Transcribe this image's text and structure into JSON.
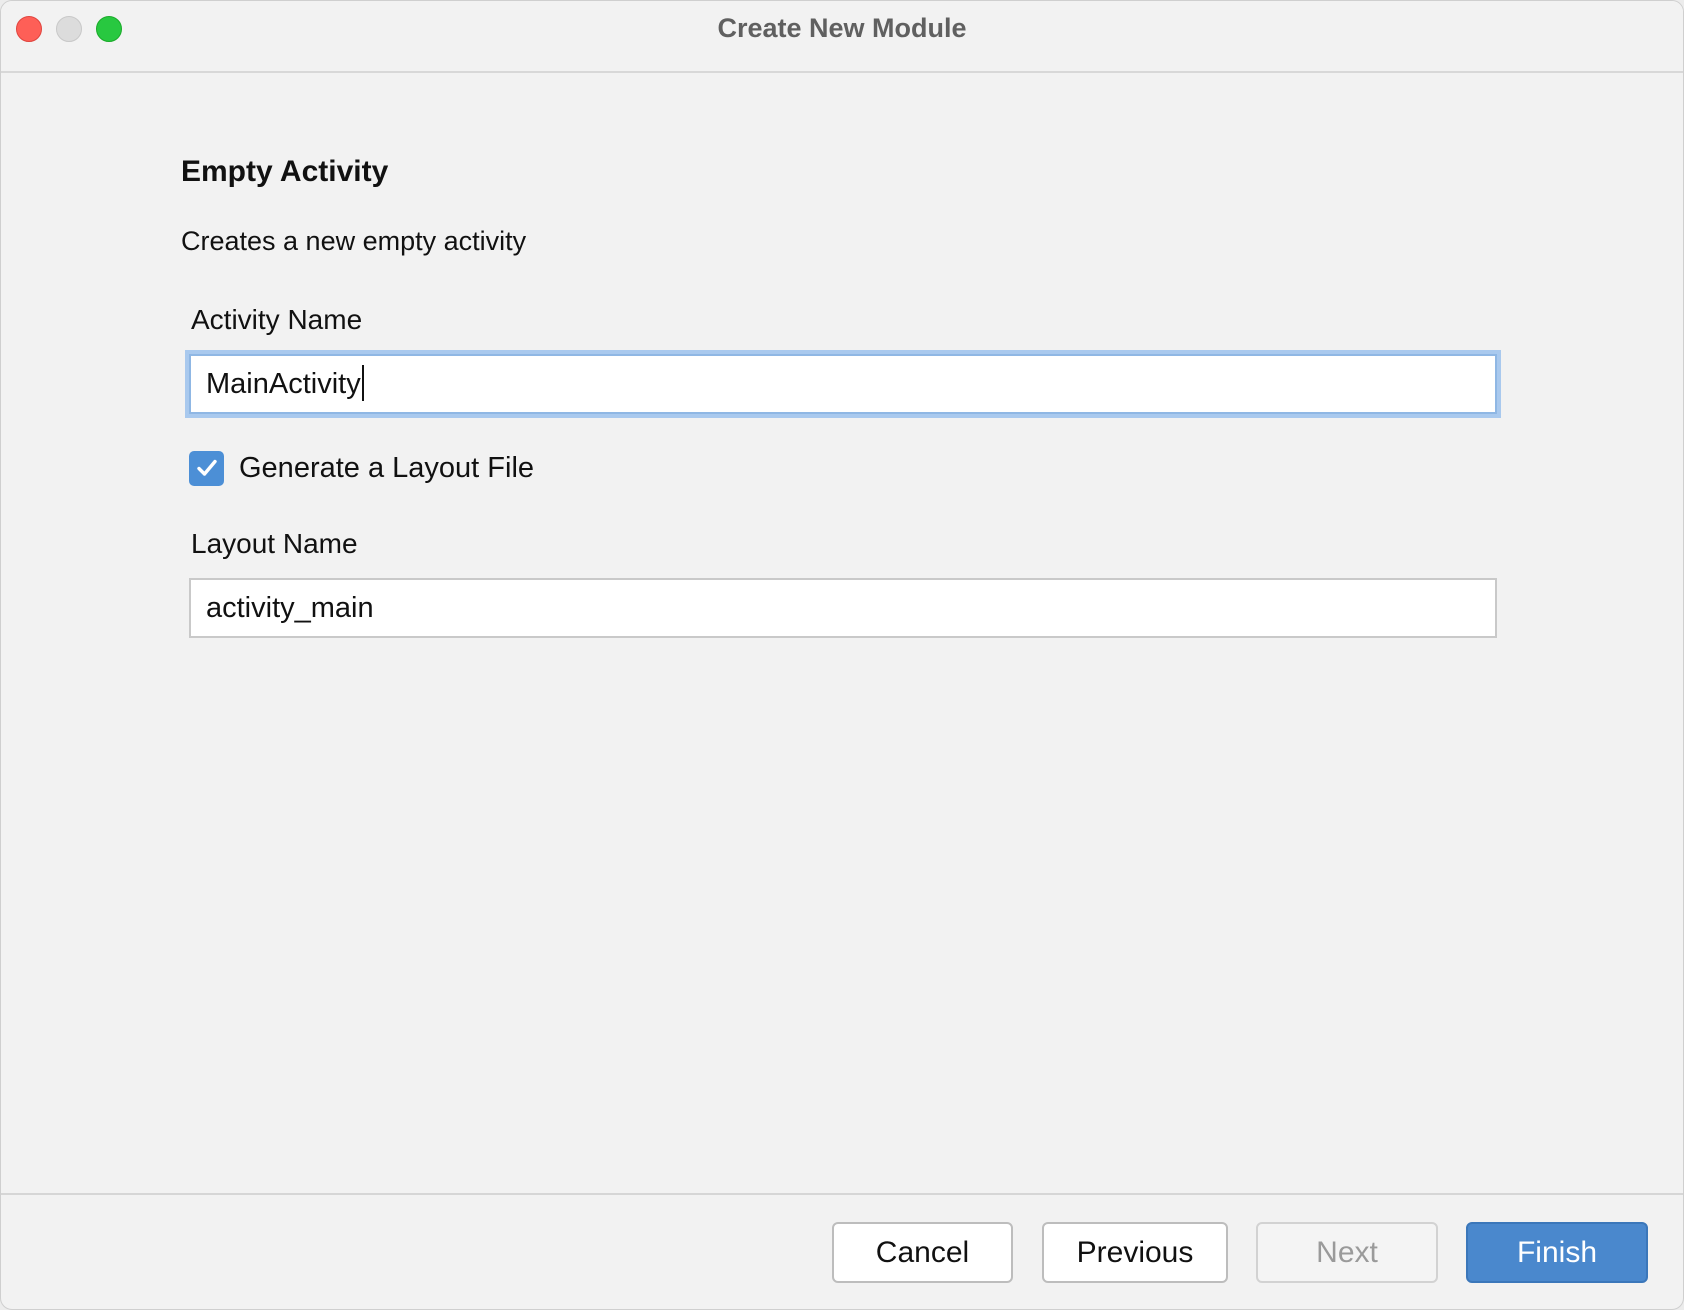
{
  "window": {
    "title": "Create New Module"
  },
  "content": {
    "heading": "Empty Activity",
    "description": "Creates a new empty activity",
    "activity_name": {
      "label": "Activity Name",
      "value": "MainActivity",
      "focused": true
    },
    "generate_layout": {
      "label": "Generate a Layout File",
      "checked": true
    },
    "layout_name": {
      "label": "Layout Name",
      "value": "activity_main"
    }
  },
  "footer": {
    "cancel_label": "Cancel",
    "previous_label": "Previous",
    "next_label": "Next",
    "finish_label": "Finish"
  },
  "colors": {
    "accent": "#4a88cd",
    "focus_ring": "#a9c9ee",
    "close": "#fe5f57",
    "minimize": "#dcdcdc",
    "maximize": "#28c840"
  }
}
